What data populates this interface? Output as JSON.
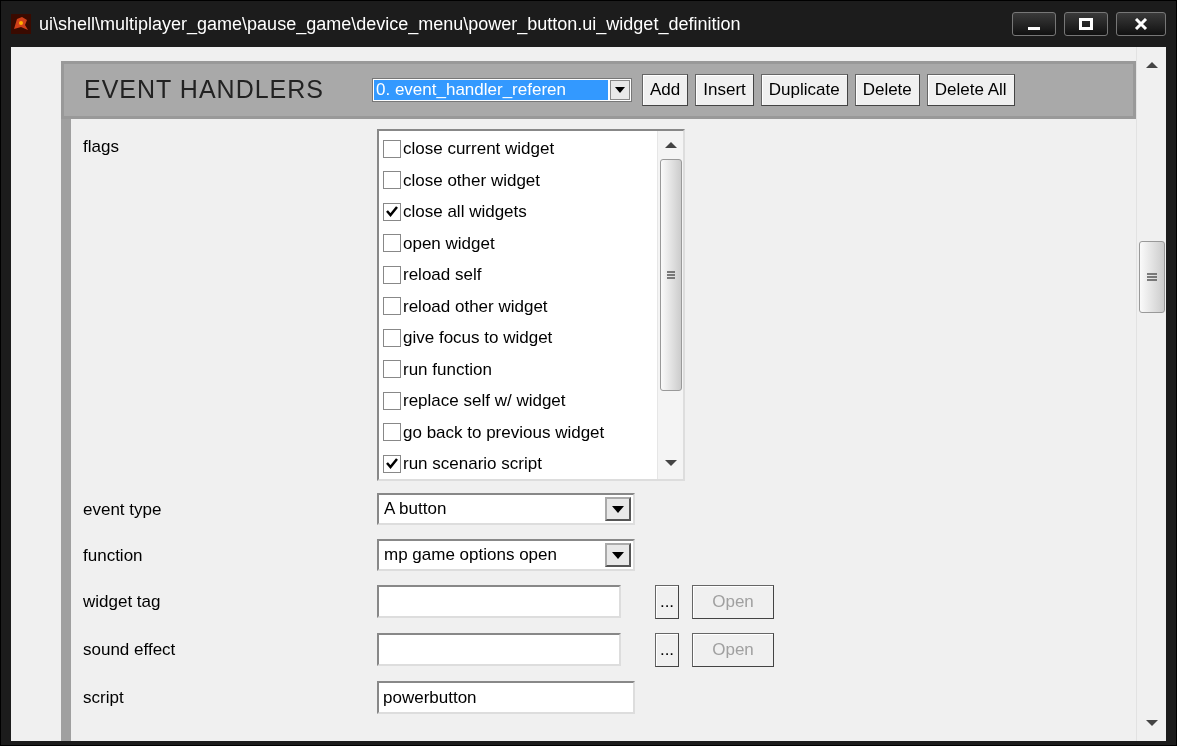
{
  "window": {
    "title": "ui\\shell\\multiplayer_game\\pause_game\\device_menu\\power_button.ui_widget_definition"
  },
  "header": {
    "title": "EVENT HANDLERS",
    "selector": {
      "value": "0. event_handler_referen"
    },
    "buttons": [
      {
        "label": "Add"
      },
      {
        "label": "Insert"
      },
      {
        "label": "Duplicate"
      },
      {
        "label": "Delete"
      },
      {
        "label": "Delete All"
      }
    ]
  },
  "fields": [
    {
      "kind": "checklist",
      "label": "flags",
      "items": [
        {
          "label": "close current widget",
          "checked": false
        },
        {
          "label": "close other widget",
          "checked": false
        },
        {
          "label": "close all widgets",
          "checked": true
        },
        {
          "label": "open widget",
          "checked": false
        },
        {
          "label": "reload self",
          "checked": false
        },
        {
          "label": "reload other widget",
          "checked": false
        },
        {
          "label": "give focus to widget",
          "checked": false
        },
        {
          "label": "run function",
          "checked": false
        },
        {
          "label": "replace self w/ widget",
          "checked": false
        },
        {
          "label": "go back to previous widget",
          "checked": false
        },
        {
          "label": "run scenario script",
          "checked": true
        }
      ]
    },
    {
      "kind": "dropdown",
      "label": "event type",
      "value": "A button"
    },
    {
      "kind": "dropdown",
      "label": "function",
      "value": "mp game options open"
    },
    {
      "kind": "tag",
      "label": "widget tag",
      "browse": {
        "label": "..."
      },
      "open": {
        "label": "Open",
        "disabled": true
      }
    },
    {
      "kind": "tag",
      "label": "sound effect",
      "browse": {
        "label": "..."
      },
      "open": {
        "label": "Open",
        "disabled": true
      }
    },
    {
      "kind": "text",
      "label": "script",
      "value": "powerbutton"
    }
  ]
}
